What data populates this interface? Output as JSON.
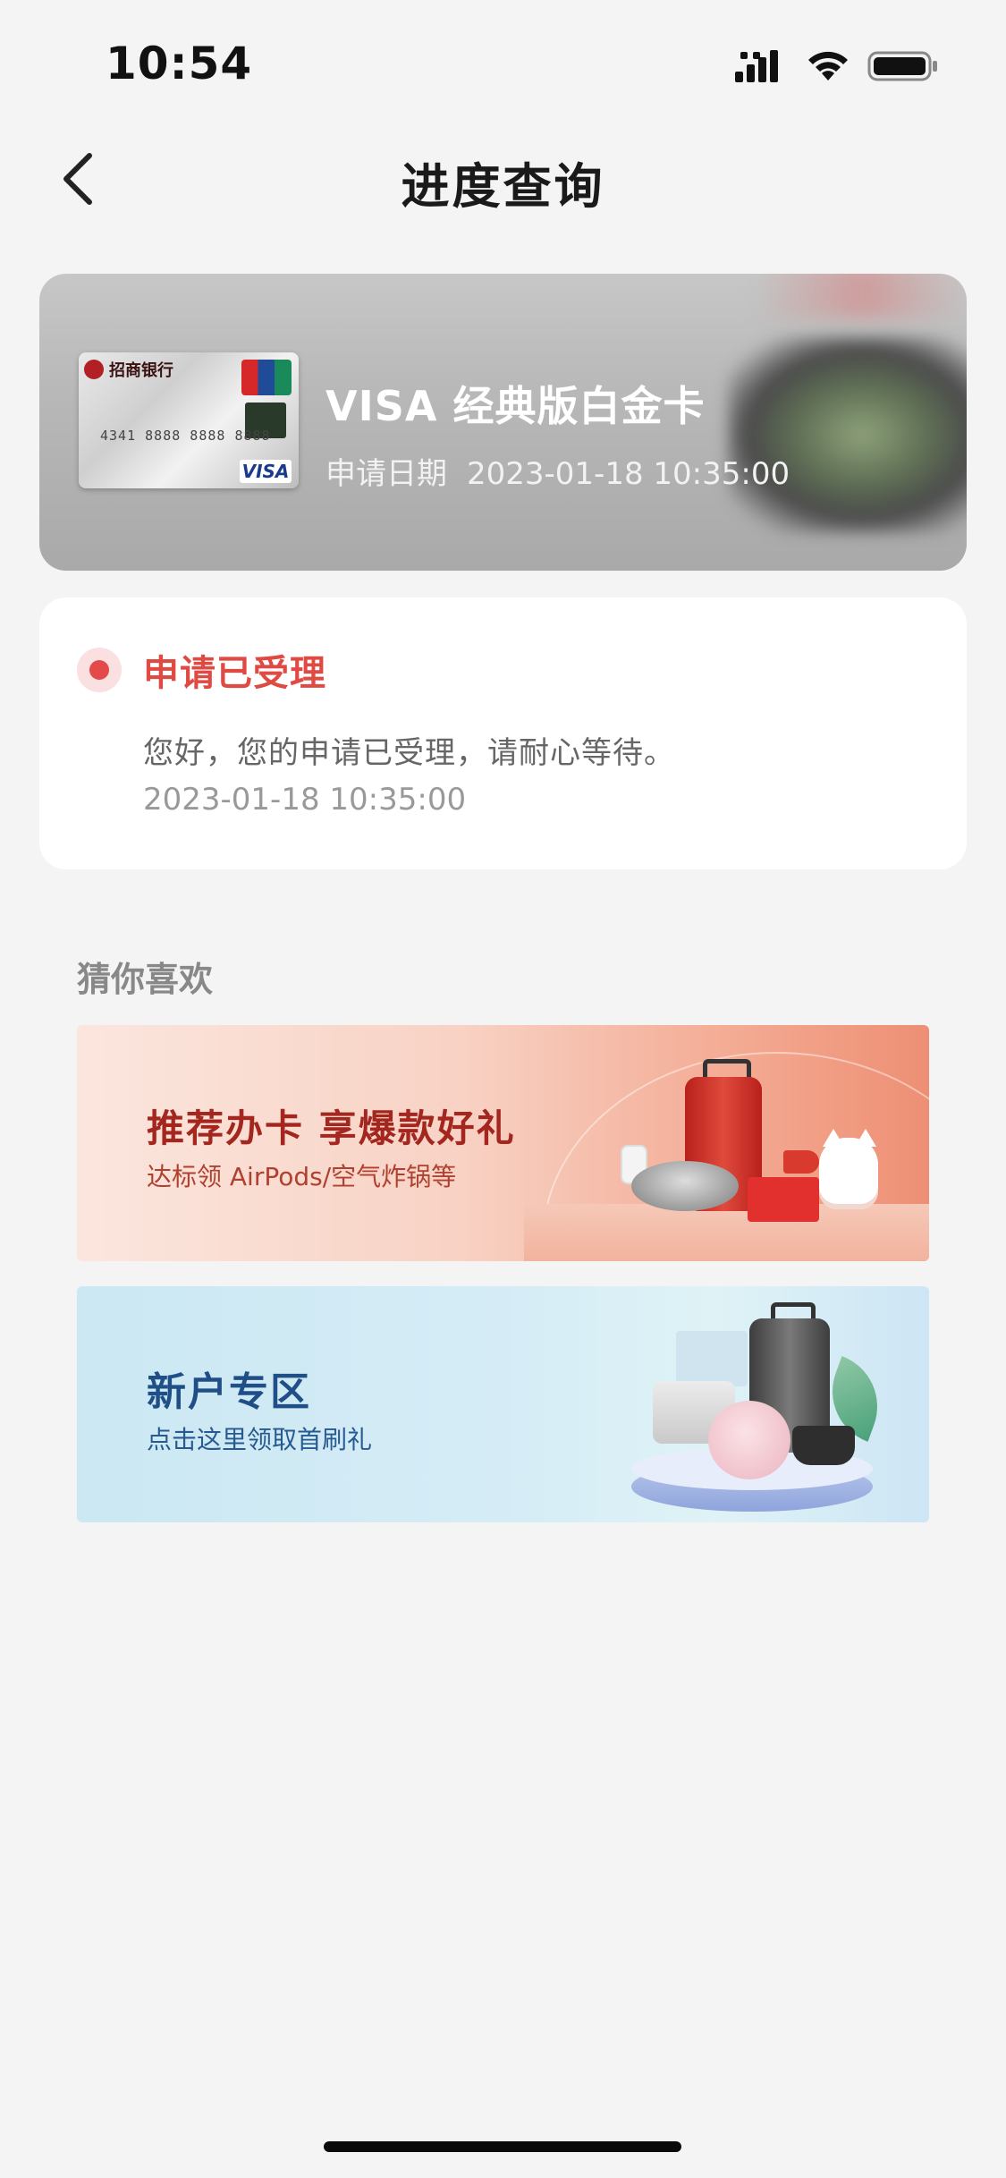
{
  "status_bar": {
    "time": "10:54",
    "icons": [
      "signal-icon",
      "wifi-icon",
      "battery-icon"
    ]
  },
  "nav": {
    "back_icon": "chevron-left-icon",
    "title": "进度查询"
  },
  "card": {
    "name": "VISA 经典版白金卡",
    "apply_date_label": "申请日期",
    "apply_date_value": "2023-01-18 10:35:00",
    "thumbnail": {
      "bank": "招商银行",
      "number": "4341 8888 8888 8888",
      "network": "VISA"
    }
  },
  "status": {
    "title": "申请已受理",
    "message": "您好，您的申请已受理，请耐心等待。",
    "time": "2023-01-18 10:35:00",
    "accent": "#df4a43"
  },
  "recommend": {
    "title": "猜你喜欢",
    "banners": [
      {
        "title": "推荐办卡 享爆款好礼",
        "subtitle": "达标领 AirPods/空气炸锅等"
      },
      {
        "title": "新户专区",
        "subtitle": "点击这里领取首刷礼"
      }
    ]
  }
}
